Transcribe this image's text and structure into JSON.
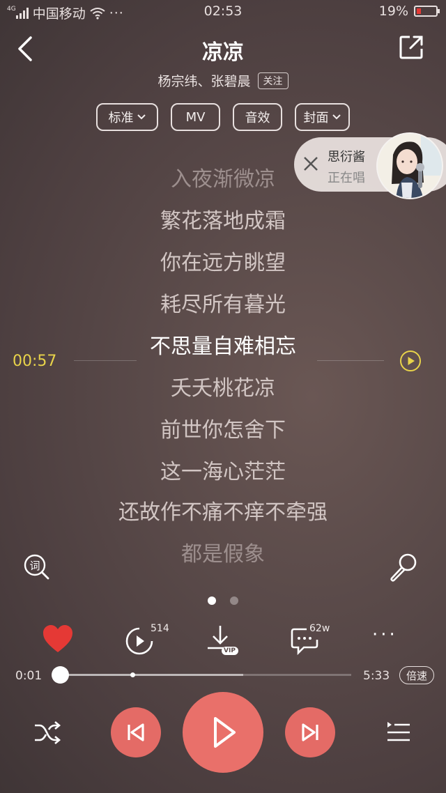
{
  "status_bar": {
    "carrier": "中国移动",
    "network": "4G",
    "time": "02:53",
    "battery": "19%"
  },
  "header": {
    "title": "凉凉",
    "artist": "杨宗纬、张碧晨",
    "follow_label": "关注"
  },
  "options": [
    {
      "label": "标准",
      "dropdown": true
    },
    {
      "label": "MV",
      "dropdown": false
    },
    {
      "label": "音效",
      "dropdown": false
    },
    {
      "label": "封面",
      "dropdown": true
    }
  ],
  "singing_card": {
    "name": "思衍酱",
    "status": "正在唱"
  },
  "lyrics": [
    {
      "text": "入夜渐微凉",
      "state": "dim"
    },
    {
      "text": "繁花落地成霜",
      "state": "normal"
    },
    {
      "text": "你在远方眺望",
      "state": "normal"
    },
    {
      "text": "耗尽所有暮光",
      "state": "normal"
    },
    {
      "text": "不思量自难相忘",
      "state": "current"
    },
    {
      "text": "夭夭桃花凉",
      "state": "normal"
    },
    {
      "text": "前世你怎舍下",
      "state": "normal"
    },
    {
      "text": "这一海心茫茫",
      "state": "normal"
    },
    {
      "text": "还故作不痛不痒不牵强",
      "state": "normal"
    },
    {
      "text": "都是假象",
      "state": "dim"
    }
  ],
  "lyric_timeline": {
    "time": "00:57"
  },
  "actions": {
    "video_count": "514",
    "comment_count": "62w",
    "download_badge": "VIP"
  },
  "player": {
    "current_time": "0:01",
    "total_time": "5:33",
    "speed_label": "倍速",
    "progress_fraction": 0.003,
    "buffer_fraction": 0.63
  },
  "colors": {
    "accent": "#e9706a",
    "timeline": "#e8d34a",
    "like": "#e53935"
  }
}
